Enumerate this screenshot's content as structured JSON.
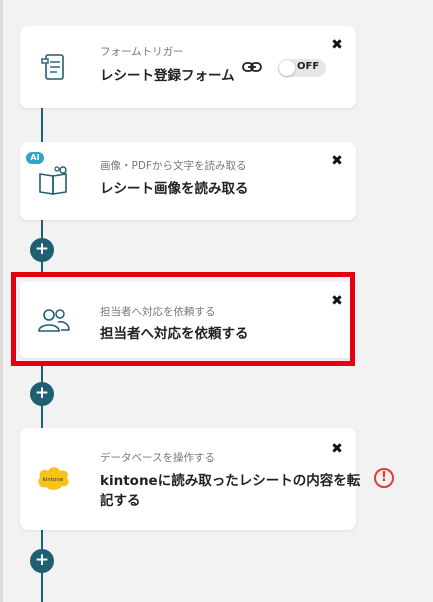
{
  "flow": {
    "steps": [
      {
        "category": "フォームトリガー",
        "title": "レシート登録フォーム",
        "icon": "form-icon",
        "toggle_label": "OFF"
      },
      {
        "category": "画像・PDFから文字を読み取る",
        "title": "レシート画像を読み取る",
        "icon": "ocr-book-icon",
        "badge": "AI"
      },
      {
        "category": "担当者へ対応を依頼する",
        "title": "担当者へ対応を依頼する",
        "icon": "people-icon"
      },
      {
        "category": "データベースを操作する",
        "title_line1": "kintoneに読み取ったレシートの内容を転",
        "title_line2": "記する",
        "icon": "kintone-icon",
        "logo_text": "kintone"
      }
    ],
    "close_glyph": "✖",
    "add_glyph": "+",
    "warning_glyph": "!"
  },
  "colors": {
    "accent": "#1f5f72",
    "highlight": "#e4000f",
    "warning": "#e23b3b",
    "kintone_yellow": "#f7c21a"
  }
}
